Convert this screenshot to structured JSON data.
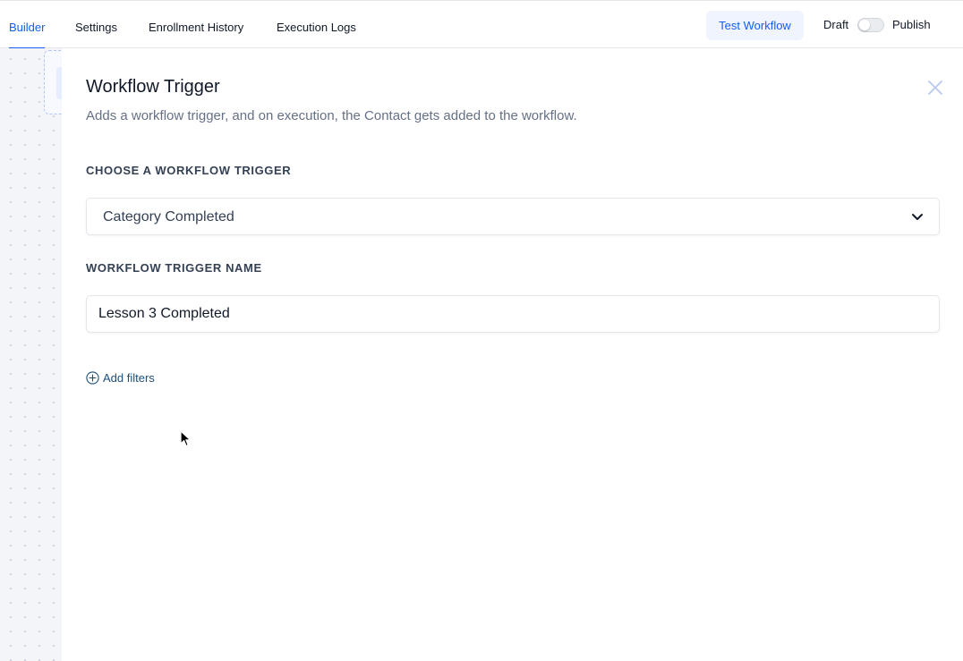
{
  "nav": {
    "tabs": [
      {
        "label": "Builder",
        "active": true
      },
      {
        "label": "Settings",
        "active": false
      },
      {
        "label": "Enrollment History",
        "active": false
      },
      {
        "label": "Execution Logs",
        "active": false
      }
    ],
    "test_button": "Test Workflow",
    "status_left": "Draft",
    "status_right": "Publish",
    "publish_toggle_on": false
  },
  "panel": {
    "title": "Workflow Trigger",
    "subtitle": "Adds a workflow trigger, and on execution, the Contact gets added to the workflow.",
    "close_icon": "close-icon",
    "trigger_label": "CHOOSE A WORKFLOW TRIGGER",
    "trigger_value": "Category Completed",
    "trigger_chevron_icon": "chevron-down-icon",
    "name_label": "WORKFLOW TRIGGER NAME",
    "name_value": "Lesson 3 Completed",
    "add_filters_icon": "plus-circle-icon",
    "add_filters_label": "Add filters"
  },
  "colors": {
    "accent": "#155eef",
    "accent_soft": "#eff4ff",
    "muted_text": "#667085",
    "label_text": "#344054",
    "link_text": "#1d4f7a",
    "border": "#e4e7ec",
    "canvas_bg": "#f4f5f8"
  }
}
